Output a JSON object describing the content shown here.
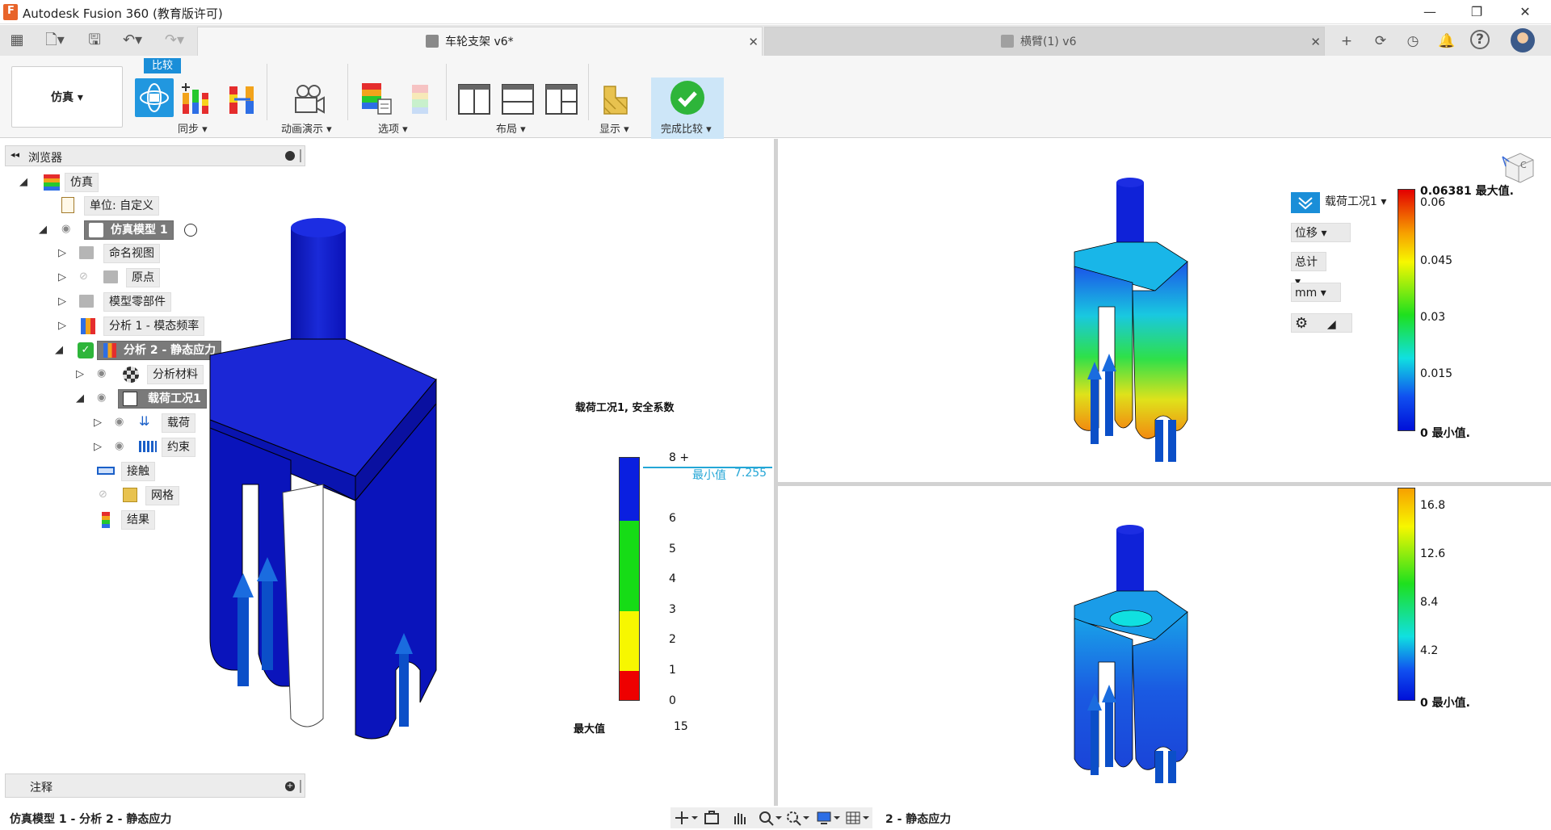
{
  "app": {
    "title": "Autodesk Fusion 360 (教育版许可)"
  },
  "window": {
    "minimize": "—",
    "restore": "❐",
    "close": "✕"
  },
  "quick_access": {
    "grid": "▦",
    "file": "🗋▾",
    "save": "🖫",
    "undo": "↶▾",
    "redo": "↷▾"
  },
  "tabs": [
    {
      "label": "车轮支架 v6*",
      "close": "✕"
    },
    {
      "label": "横臂(1) v6",
      "close": "✕"
    }
  ],
  "tab_actions": {
    "new": "+",
    "sync": "⟳",
    "jobs": "◷",
    "notify": "🔔",
    "help": "?"
  },
  "toolbar": {
    "workspace": "仿真 ▾",
    "compare_tag": "比较",
    "sync_label": "同步 ▾",
    "animate_label": "动画演示 ▾",
    "options_label": "选项 ▾",
    "layout_label": "布局 ▾",
    "display_label": "显示 ▾",
    "finish_label": "完成比较 ▾"
  },
  "browser": {
    "title": "浏览器",
    "collapse": "◂◂",
    "items": [
      {
        "label": "仿真"
      },
      {
        "label": "单位: 自定义"
      },
      {
        "label": "仿真模型 1"
      },
      {
        "label": "命名视图"
      },
      {
        "label": "原点"
      },
      {
        "label": "模型零部件"
      },
      {
        "label": "分析 1 - 模态频率"
      },
      {
        "label": "分析 2 - 静态应力"
      },
      {
        "label": "分析材料"
      },
      {
        "label": "载荷工况1"
      },
      {
        "label": "载荷"
      },
      {
        "label": "约束"
      },
      {
        "label": "接触"
      },
      {
        "label": "网格"
      },
      {
        "label": "结果"
      }
    ]
  },
  "notes": {
    "title": "注释"
  },
  "status": {
    "left": "仿真模型 1 - 分析 2 - 静态应力",
    "right": "2 - 静态应力"
  },
  "left_legend": {
    "title": "载荷工况1, 安全系数",
    "ticks": [
      "8 +",
      "6",
      "5",
      "4",
      "3",
      "2",
      "1",
      "0"
    ],
    "min_label": "最小值",
    "min_value": "7.255",
    "max_label": "最大值",
    "max_value": "15",
    "colors": {
      "blue": "#0a1fe0",
      "green": "#16dc16",
      "yellow": "#f7f700",
      "red": "#ee0000"
    }
  },
  "top_right": {
    "loadcase": "载荷工况1 ▾",
    "result_type": "位移 ▾",
    "component": "总计 ▾",
    "unit": "mm ▾",
    "ticks": [
      "0.06381 最大值.",
      "0.06",
      "0.045",
      "0.03",
      "0.015",
      "0 最小值."
    ]
  },
  "bottom_right": {
    "ticks": [
      "16.8",
      "12.6",
      "8.4",
      "4.2",
      "0 最小值."
    ]
  },
  "viewcube": {
    "label": "C"
  },
  "nav_icons": [
    "move-icon",
    "look-icon",
    "pan-icon",
    "zoom-icon",
    "fit-icon",
    "display-icon",
    "grid-icon"
  ]
}
